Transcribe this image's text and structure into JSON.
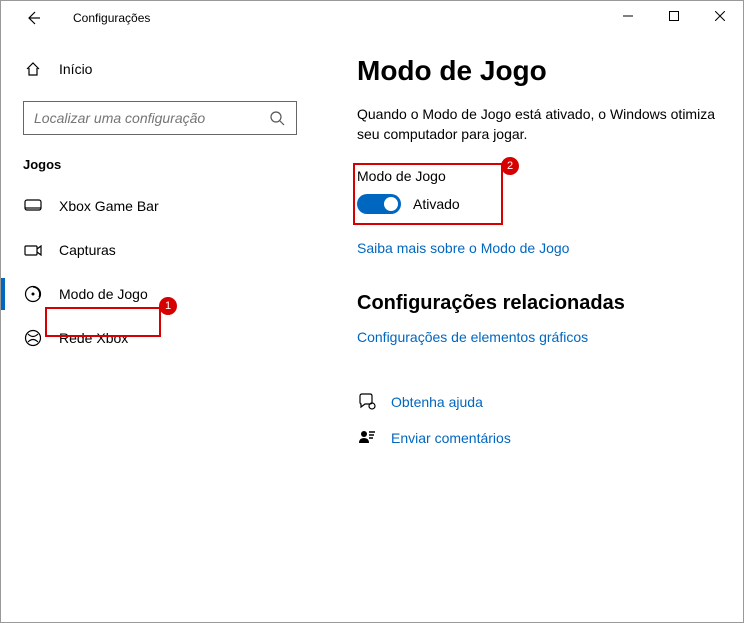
{
  "window": {
    "title": "Configurações"
  },
  "sidebar": {
    "home": "Início",
    "search_placeholder": "Localizar uma configuração",
    "category": "Jogos",
    "items": [
      {
        "label": "Xbox Game Bar"
      },
      {
        "label": "Capturas"
      },
      {
        "label": "Modo de Jogo"
      },
      {
        "label": "Rede Xbox"
      }
    ]
  },
  "annotations": {
    "badge1": "1",
    "badge2": "2"
  },
  "main": {
    "heading": "Modo de Jogo",
    "description": "Quando o Modo de Jogo está ativado, o Windows otimiza seu computador para jogar.",
    "toggle_label": "Modo de Jogo",
    "toggle_state": "Ativado",
    "learn_more": "Saiba mais sobre o Modo de Jogo",
    "related_heading": "Configurações relacionadas",
    "related_link": "Configurações de elementos gráficos",
    "help": "Obtenha ajuda",
    "feedback": "Enviar comentários"
  }
}
